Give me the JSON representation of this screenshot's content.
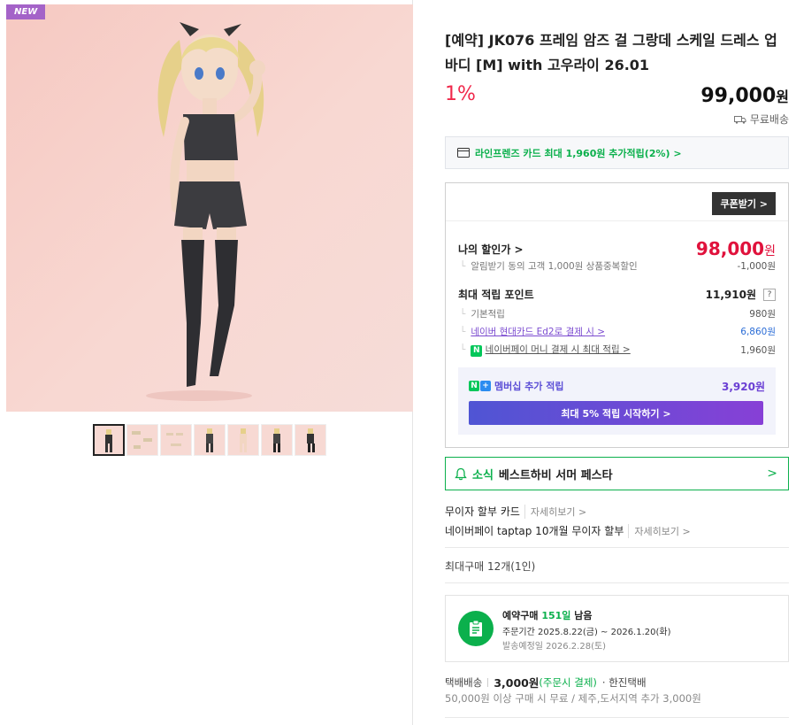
{
  "product": {
    "badge": "NEW",
    "title": "[예약] JK076 프레임 암즈 걸 그랑데 스케일 드레스 업 바디 [M] with 고우라이 26.01",
    "discount_rate": "1%",
    "price": "99,000",
    "price_unit": "원",
    "shipping_label": "무료배송"
  },
  "thumbnails": [
    {
      "name": "thumb-1"
    },
    {
      "name": "thumb-2"
    },
    {
      "name": "thumb-3"
    },
    {
      "name": "thumb-4"
    },
    {
      "name": "thumb-5"
    },
    {
      "name": "thumb-6"
    },
    {
      "name": "thumb-7"
    }
  ],
  "card_promo": "라인프렌즈 카드 최대 1,960원 추가적립(2%) >",
  "benefit": {
    "coupon_button": "쿠폰받기 >",
    "my_price_label": "나의 할인가 >",
    "my_price": "98,000",
    "my_price_unit": "원",
    "alarm_discount_label": "알림받기 동의 고객 1,000원 상품중복할인",
    "alarm_discount_value": "-1,000원",
    "max_point_label": "최대 적립 포인트",
    "max_point_value": "11,910원",
    "max_point_help": "?",
    "base_point_label": "기본적립",
    "base_point_value": "980원",
    "hyundai_label": "네이버 현대카드 Ed2로 결제 시 >",
    "hyundai_value": "6,860원",
    "npay_label": "네이버페이 머니 결제 시 최대 적립 >",
    "npay_value": "1,960원",
    "membership_label": "멤버십 추가 적립",
    "membership_value": "3,920원",
    "membership_button": "최대 5% 적립 시작하기 >"
  },
  "news": {
    "tag": "소식",
    "text": "베스트하비 서머 페스타"
  },
  "installments": [
    {
      "label": "무이자 할부 카드",
      "more": "자세히보기 >"
    },
    {
      "label": "네이버페이 taptap 10개월 무이자 할부",
      "more": "자세히보기 >"
    }
  ],
  "max_purchase": "최대구매 12개(1인)",
  "preorder": {
    "title_prefix": "예약구매",
    "days": "151일",
    "title_suffix": "남음",
    "order_period": "주문기간  2025.8.22(금) ~ 2026.1.20(화)",
    "ship_date": "발송예정일  2026.2.28(토)"
  },
  "delivery": {
    "type": "택배배송",
    "fee": "3,000원",
    "fee_note": "(주문시 결제)",
    "carrier": "· 한진택배",
    "condition": "50,000원 이상 구매 시 무료 / 제주,도서지역 추가 3,000원"
  },
  "colors": {
    "naver_green": "#0bb04c",
    "price_red": "#e0123c",
    "discount_red": "#f0284b",
    "membership_purple": "#6b3fd4"
  }
}
